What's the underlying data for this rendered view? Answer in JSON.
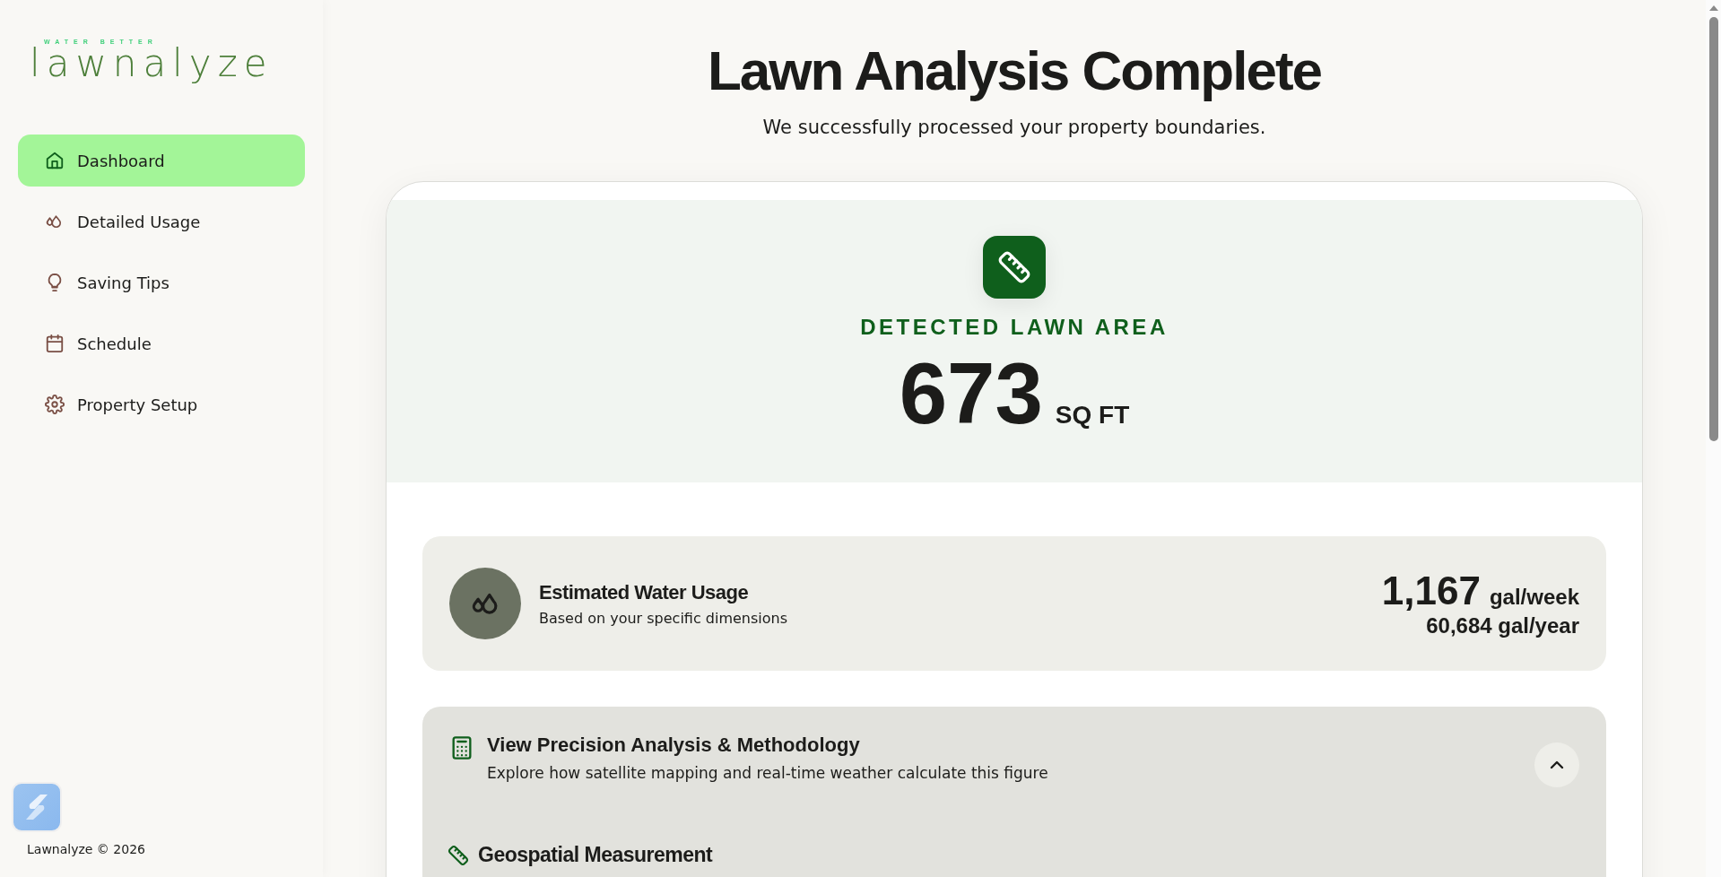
{
  "logo": {
    "tagline": "WATER BETTER",
    "name": "lawnalyze"
  },
  "sidebar": {
    "items": [
      {
        "label": "Dashboard",
        "selected": true
      },
      {
        "label": "Detailed Usage",
        "selected": false
      },
      {
        "label": "Saving Tips",
        "selected": false
      },
      {
        "label": "Schedule",
        "selected": false
      },
      {
        "label": "Property Setup",
        "selected": false
      }
    ],
    "footer": "Lawnalyze © 2026"
  },
  "header": {
    "title": "Lawn Analysis Complete",
    "subtitle": "We successfully processed your property boundaries."
  },
  "area": {
    "label": "DETECTED LAWN AREA",
    "value": "673",
    "unit": "SQ FT"
  },
  "water": {
    "title": "Estimated Water Usage",
    "subtitle": "Based on your specific dimensions",
    "weekly_value": "1,167",
    "weekly_unit": "gal/week",
    "yearly": "60,684 gal/year"
  },
  "methodology": {
    "title": "View Precision Analysis & Methodology",
    "subtitle": "Explore how satellite mapping and real-time weather calculate this figure",
    "expanded": true,
    "sections": [
      {
        "title": "Geospatial Measurement"
      }
    ]
  }
}
